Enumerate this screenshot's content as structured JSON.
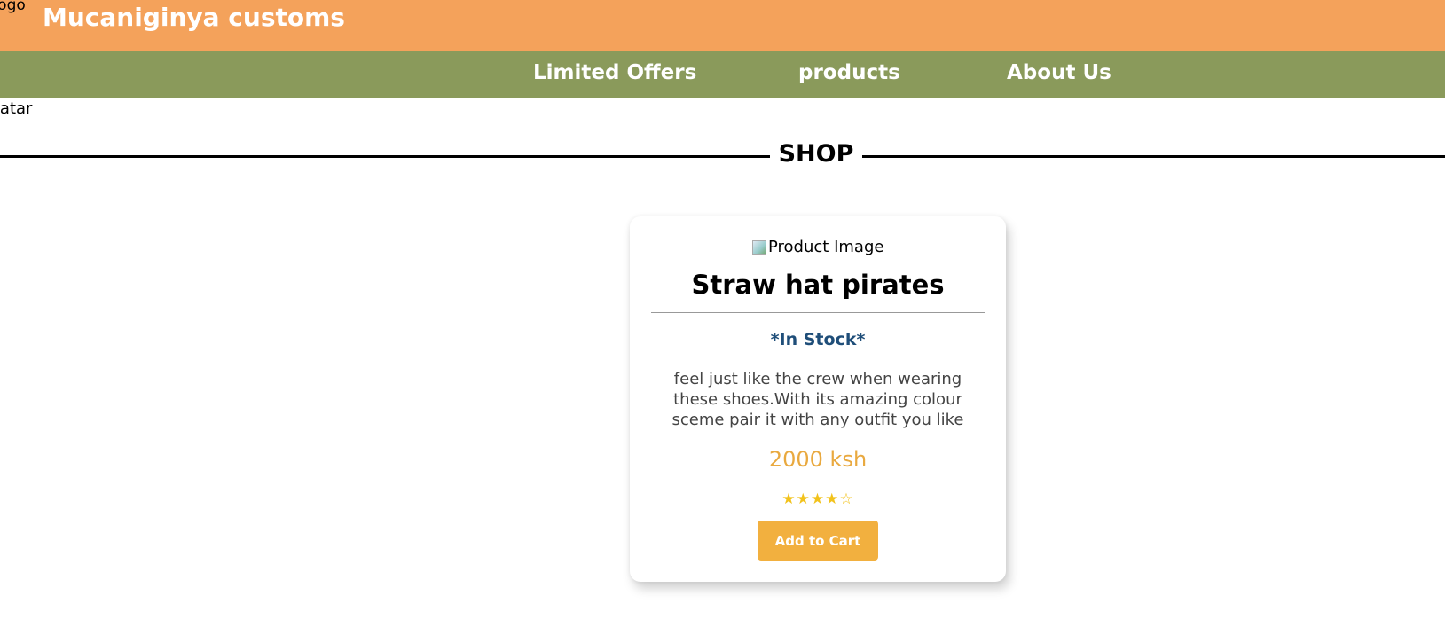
{
  "header": {
    "logo_alt": "Logo",
    "brand": "Mucaniginya customs",
    "background": "#f4a25b"
  },
  "nav": {
    "background": "#8a9a5b",
    "items": [
      {
        "label": "Limited Offers"
      },
      {
        "label": "products"
      },
      {
        "label": "About Us"
      }
    ]
  },
  "avatar_alt": "Avatar",
  "shop_heading": "SHOP",
  "product": {
    "image_alt": "Product Image",
    "title": "Straw hat pirates",
    "stock": "*In Stock*",
    "description": "feel just like the crew when wearing these shoes.With its amazing colour sceme pair it with any outfit you like",
    "price": "2000 ksh",
    "rating_stars": "★★★★☆",
    "rating": 4,
    "rating_max": 5,
    "button": "Add to Cart",
    "accent": "#f2b03f"
  }
}
